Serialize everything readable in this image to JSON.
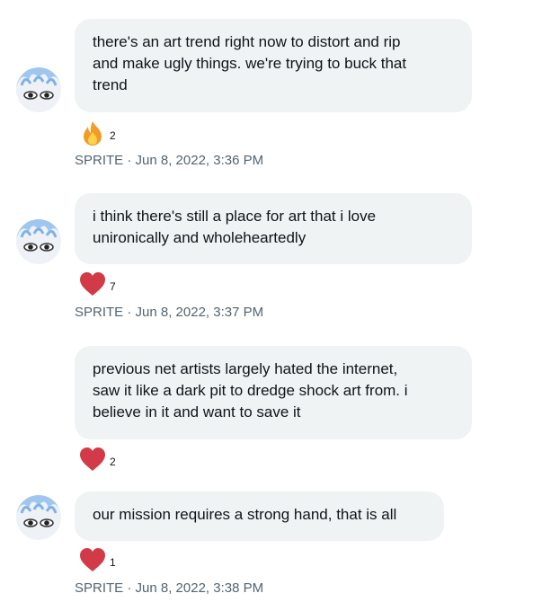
{
  "messages": [
    {
      "lines": [
        "there's an art trend right now to distort and rip",
        "and make ugly things. we're trying to buck that",
        "trend"
      ],
      "reaction": {
        "icon": "fire-icon",
        "count": "2"
      },
      "meta": "SPRITE · Jun 8, 2022, 3:36 PM",
      "has_avatar": true
    },
    {
      "lines": [
        "i think there's still a place for art that i love",
        "unironically and wholeheartedly"
      ],
      "reaction": {
        "icon": "heart-icon",
        "count": "7"
      },
      "meta": "SPRITE · Jun 8, 2022, 3:37 PM",
      "has_avatar": true
    },
    {
      "lines": [
        "previous net artists largely hated the internet,",
        "saw it like a dark pit to dredge shock art from. i",
        "believe in it and want to save it"
      ],
      "reaction": {
        "icon": "heart-icon",
        "count": "2"
      },
      "has_avatar": false
    },
    {
      "lines": [
        "our mission requires a strong hand, that is all"
      ],
      "reaction": {
        "icon": "heart-icon",
        "count": "1"
      },
      "meta": "SPRITE · Jun 8, 2022, 3:38 PM",
      "has_avatar": true
    }
  ],
  "colors": {
    "bubble": "#eff3f4",
    "text": "#0f1419",
    "meta": "#536471",
    "heart": "#d13a46"
  }
}
